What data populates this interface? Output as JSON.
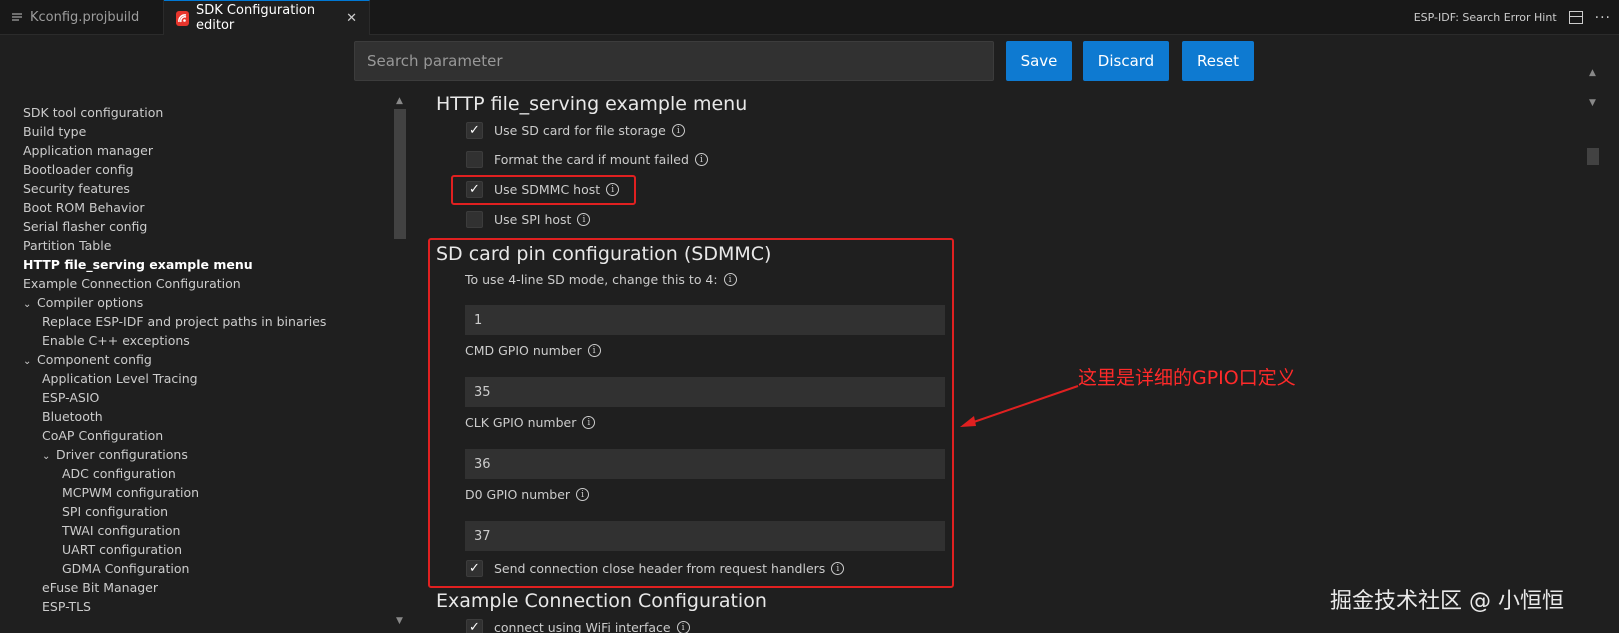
{
  "tabs": [
    {
      "label": "Kconfig.projbuild"
    },
    {
      "label": "SDK Configuration editor"
    }
  ],
  "toolbar": {
    "hint": "ESP-IDF: Search Error Hint",
    "more": "···"
  },
  "search": {
    "placeholder": "Search parameter"
  },
  "buttons": {
    "save": "Save",
    "discard": "Discard",
    "reset": "Reset"
  },
  "sidebar": {
    "items": [
      {
        "label": "SDK tool configuration"
      },
      {
        "label": "Build type"
      },
      {
        "label": "Application manager"
      },
      {
        "label": "Bootloader config"
      },
      {
        "label": "Security features"
      },
      {
        "label": "Boot ROM Behavior"
      },
      {
        "label": "Serial flasher config"
      },
      {
        "label": "Partition Table"
      },
      {
        "label": "HTTP file_serving example menu",
        "active": true
      },
      {
        "label": "Example Connection Configuration"
      },
      {
        "label": "Compiler options",
        "expanded": true
      },
      {
        "label": "Replace ESP-IDF and project paths in binaries"
      },
      {
        "label": "Enable C++ exceptions"
      },
      {
        "label": "Component config",
        "expanded": true
      },
      {
        "label": "Application Level Tracing"
      },
      {
        "label": "ESP-ASIO"
      },
      {
        "label": "Bluetooth"
      },
      {
        "label": "CoAP Configuration"
      },
      {
        "label": "Driver configurations",
        "expanded": true
      },
      {
        "label": "ADC configuration"
      },
      {
        "label": "MCPWM configuration"
      },
      {
        "label": "SPI configuration"
      },
      {
        "label": "TWAI configuration"
      },
      {
        "label": "UART configuration"
      },
      {
        "label": "GDMA Configuration"
      },
      {
        "label": "eFuse Bit Manager"
      },
      {
        "label": "ESP-TLS"
      }
    ]
  },
  "main": {
    "section1": {
      "title": "HTTP file_serving example menu",
      "options": [
        {
          "label": "Use SD card for file storage",
          "checked": true
        },
        {
          "label": "Format the card if mount failed",
          "checked": false
        },
        {
          "label": "Use SDMMC host",
          "checked": true
        },
        {
          "label": "Use SPI host",
          "checked": false
        }
      ]
    },
    "section2": {
      "title": "SD card pin configuration (SDMMC)",
      "line_mode_label": "To use 4-line SD mode, change this to 4:",
      "line_mode_value": "1",
      "cmd_label": "CMD GPIO number",
      "cmd_value": "35",
      "clk_label": "CLK GPIO number",
      "clk_value": "36",
      "d0_label": "D0 GPIO number",
      "d0_value": "37",
      "close_header_label": "Send connection close header from request handlers",
      "close_header_checked": true
    },
    "section3": {
      "title": "Example Connection Configuration",
      "wifi_label": "connect using WiFi interface"
    }
  },
  "annotation": {
    "text": "这里是详细的GPIO口定义",
    "color": "#ff2a2a"
  },
  "watermark": {
    "text": "掘金技术社区 @ 小恒恒"
  },
  "icons": {
    "check": "✓",
    "info": "i",
    "close": "✕",
    "chevron": "⌄"
  },
  "colors": {
    "accent": "#0e7ad1",
    "annotation": "#e02020",
    "background": "#1f1f1f"
  }
}
